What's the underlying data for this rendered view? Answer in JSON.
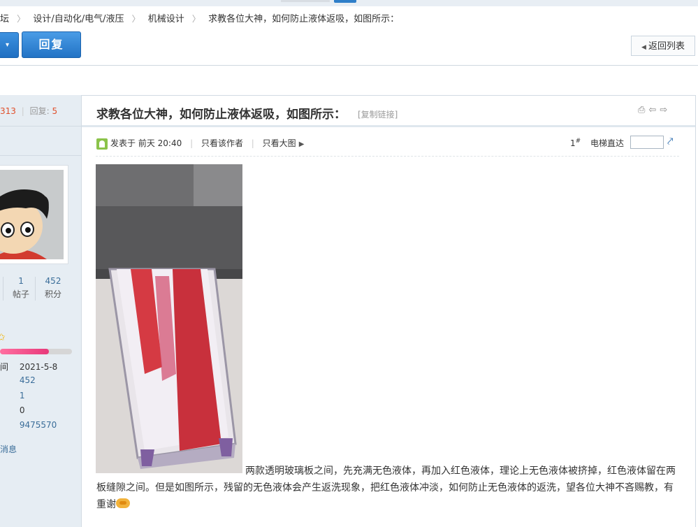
{
  "breadcrumb": {
    "items": [
      "坛",
      "设计/自动化/电气/液压",
      "机械设计",
      "求教各位大神，如何防止液体返吸，如图所示："
    ]
  },
  "toolbar": {
    "dropdown_caret": "▾",
    "reply_label": "回复",
    "back_label": "返回列表"
  },
  "thread_stats": {
    "views": "313",
    "replies_label": "回复:",
    "replies": "5"
  },
  "author": {
    "posts_value": "1",
    "posts_label": "帖子",
    "points_value": "452",
    "points_label": "积分",
    "level_progress": 0.68,
    "info": [
      {
        "label": "间",
        "value": "2021-5-8",
        "linked": false
      },
      {
        "label": "",
        "value": "452",
        "linked": true
      },
      {
        "label": "",
        "value": "1",
        "linked": true
      },
      {
        "label": "",
        "value": "0",
        "linked": false
      },
      {
        "label": "",
        "value": "9475570",
        "linked": true
      }
    ],
    "message_link": "消息"
  },
  "post": {
    "title": "求教各位大神，如何防止液体返吸，如图所示：",
    "copy_link": "[复制链接]",
    "posted_prefix": "发表于",
    "posted_time": "前天 20:40",
    "only_author": "只看该作者",
    "big_image": "只看大图",
    "floor_number": "1",
    "floor_symbol": "#",
    "elevator_label": "电梯直达",
    "body_text": "两款透明玻璃板之间，先充满无色液体，再加入红色液体，理论上无色液体被挤掉，红色液体留在两板缝隙之间。但是如图所示，残留的无色液体会产生返洗现象，把红色液体冲淡，如何防止无色液体的返洗，望各位大神不吝赐教，有重谢"
  },
  "colors": {
    "accent_blue": "#2f7fc9",
    "link_blue": "#3a6d99",
    "highlight_red": "#e0502c",
    "sidebar_bg": "#e6edf3"
  },
  "icons": [
    "print-icon",
    "prev-thread-icon",
    "next-thread-icon",
    "user-icon",
    "go-floor-icon",
    "star-icon",
    "handshake-icon"
  ]
}
